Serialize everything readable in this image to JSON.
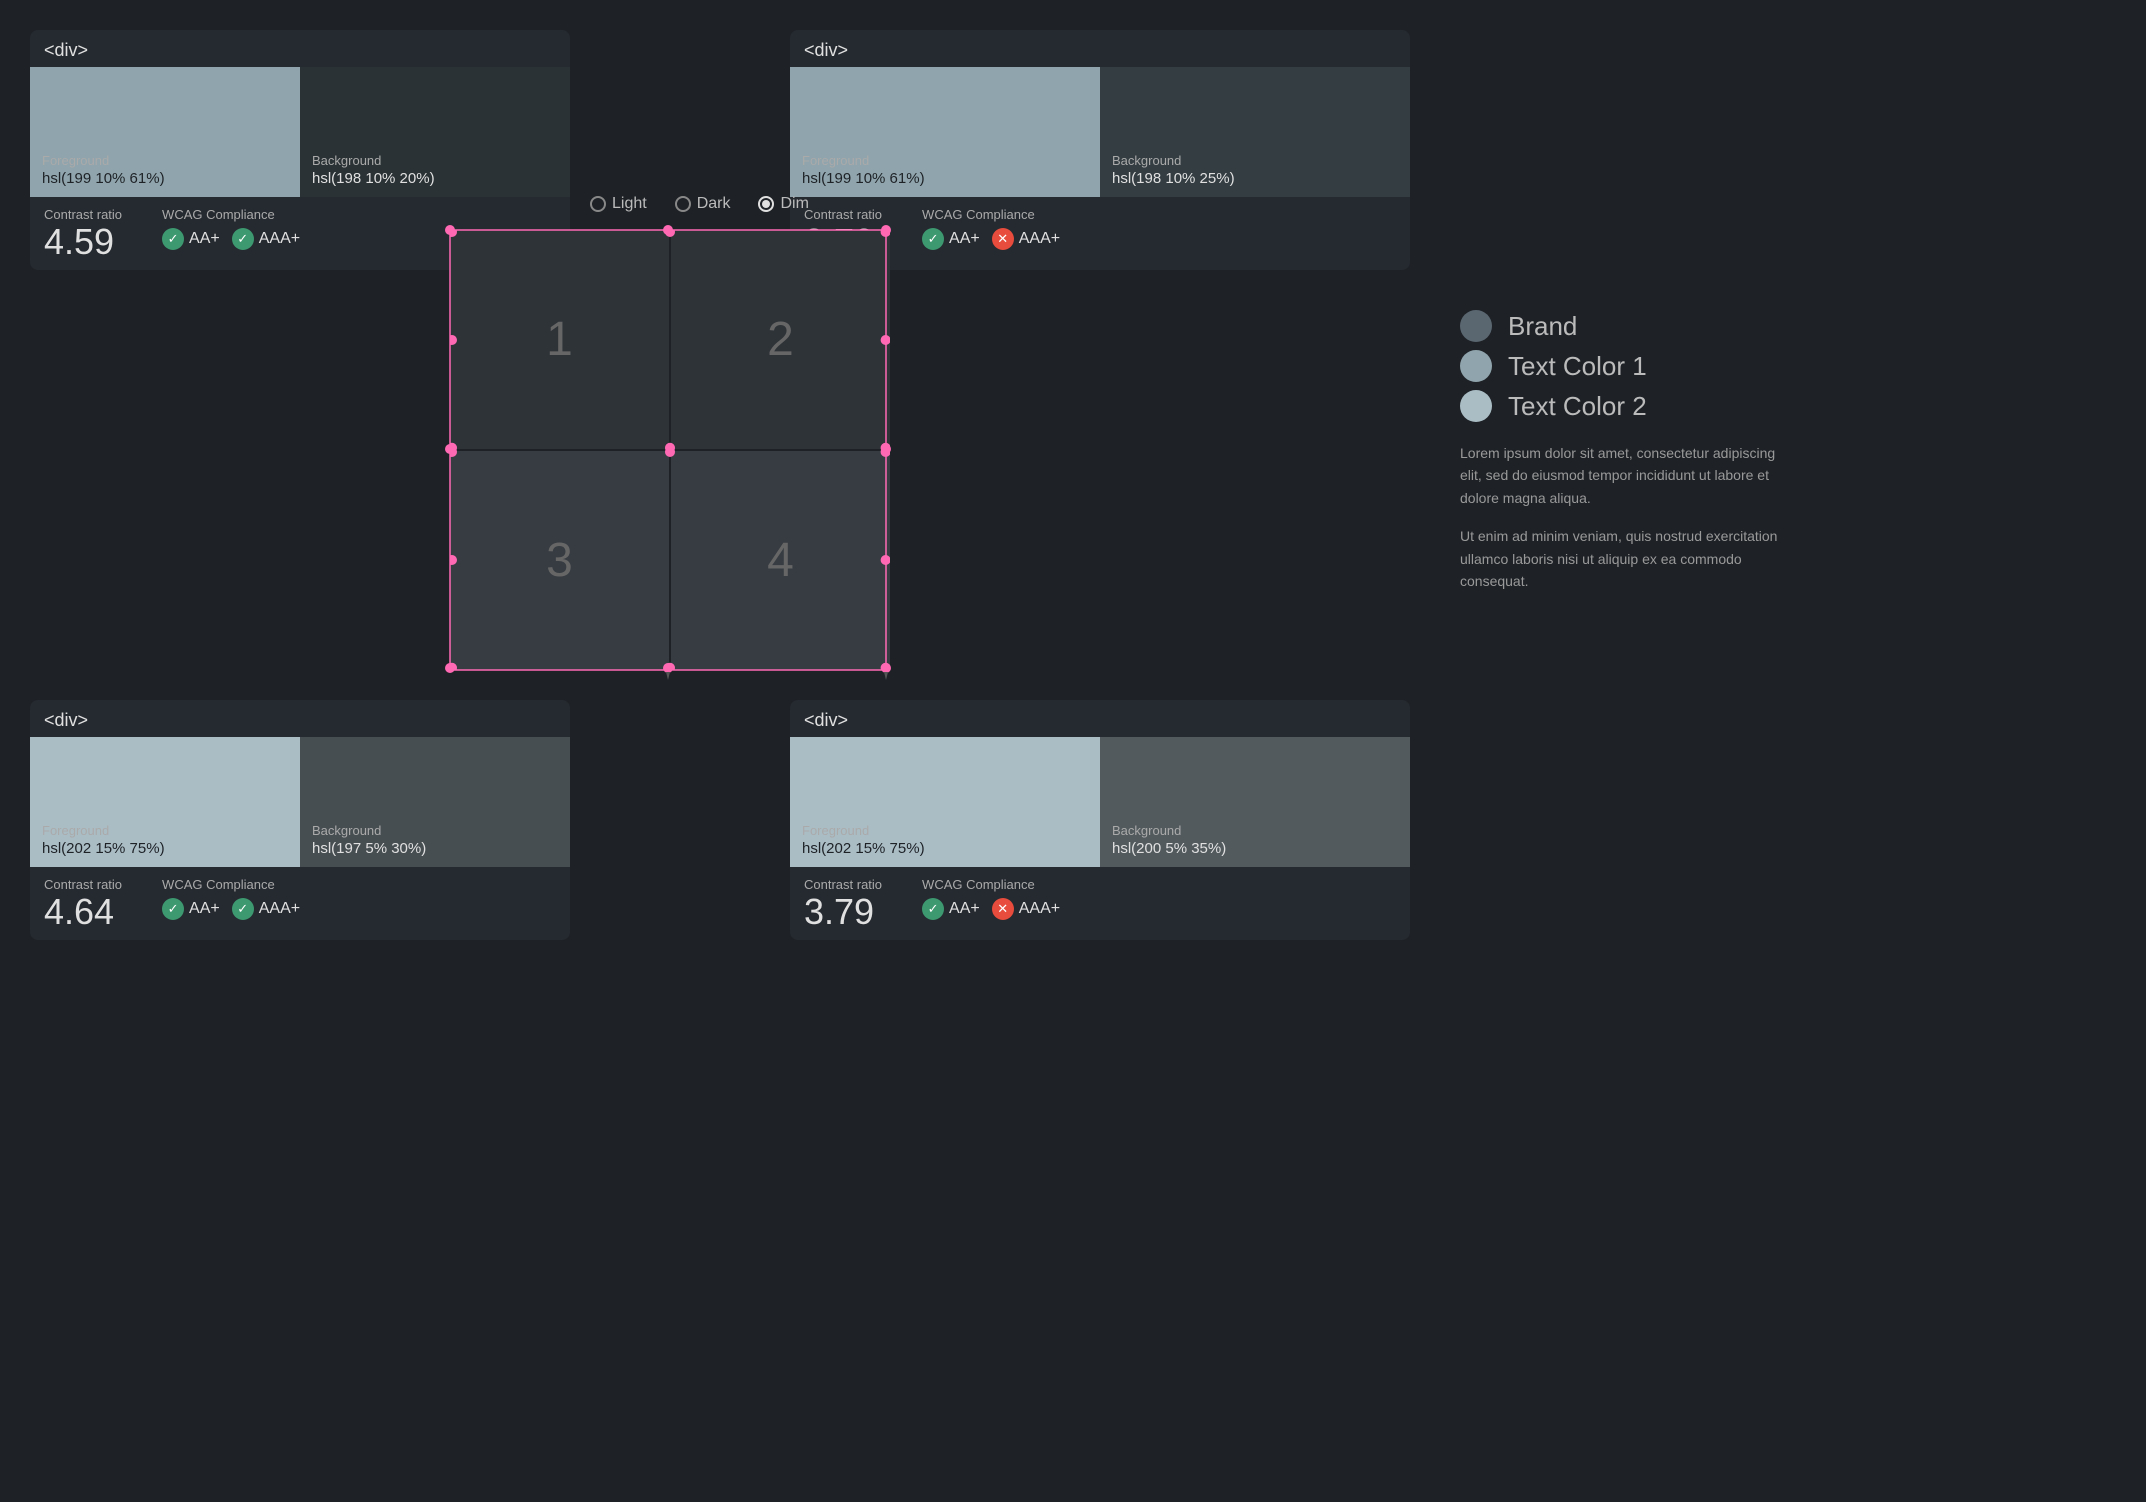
{
  "cards": {
    "top_left": {
      "tag": "<div>",
      "foreground_label": "Foreground",
      "foreground_value": "hsl(199 10% 61%)",
      "background_label": "Background",
      "background_value": "hsl(198 10% 20%)",
      "foreground_color": "#8fa4ac",
      "background_color": "#2a3235",
      "contrast_label": "Contrast ratio",
      "contrast_value": "4.59",
      "wcag_label": "WCAG Compliance",
      "badge_aa": "AA+",
      "badge_aaa": "AAA+",
      "aa_pass": true,
      "aaa_pass": true
    },
    "top_right": {
      "tag": "<div>",
      "foreground_label": "Foreground",
      "foreground_value": "hsl(199 10% 61%)",
      "background_label": "Background",
      "background_value": "hsl(198 10% 25%)",
      "foreground_color": "#8fa4ac",
      "background_color": "#333d42",
      "contrast_label": "Contrast ratio",
      "contrast_value": "3.78",
      "wcag_label": "WCAG Compliance",
      "badge_aa": "AA+",
      "badge_aaa": "AAA+",
      "aa_pass": true,
      "aaa_pass": false
    },
    "bottom_left": {
      "tag": "<div>",
      "foreground_label": "Foreground",
      "foreground_value": "hsl(202 15% 75%)",
      "background_label": "Background",
      "background_value": "hsl(197 5% 30%)",
      "foreground_color": "#aabdc5",
      "background_color": "#474e52",
      "contrast_label": "Contrast ratio",
      "contrast_value": "4.64",
      "wcag_label": "WCAG Compliance",
      "badge_aa": "AA+",
      "badge_aaa": "AAA+",
      "aa_pass": true,
      "aaa_pass": true
    },
    "bottom_right": {
      "tag": "<div>",
      "foreground_label": "Foreground",
      "foreground_value": "hsl(202 15% 75%)",
      "background_label": "Background",
      "background_value": "hsl(200 5% 35%)",
      "foreground_color": "#aabdc5",
      "background_color": "#525a5e",
      "contrast_label": "Contrast ratio",
      "contrast_value": "3.79",
      "wcag_label": "WCAG Compliance",
      "badge_aa": "AA+",
      "badge_aaa": "AAA+",
      "aa_pass": true,
      "aaa_pass": false
    }
  },
  "radio": {
    "light_label": "Light",
    "dark_label": "Dark",
    "dim_label": "Dim",
    "selected": "dim"
  },
  "grid": {
    "cells": [
      "1",
      "2",
      "3",
      "4"
    ]
  },
  "brand_items": [
    {
      "label": "Brand",
      "color": "#5a6670"
    },
    {
      "label": "Text Color 1",
      "color": "#8fa4ac"
    },
    {
      "label": "Text Color 2",
      "color": "#aabdc5"
    }
  ],
  "lorem": {
    "p1": "Lorem ipsum dolor sit amet, consectetur adipiscing elit, sed do eiusmod tempor incididunt ut labore et dolore magna aliqua.",
    "p2": "Ut enim ad minim veniam, quis nostrud exercitation ullamco laboris nisi ut aliquip ex ea commodo consequat."
  }
}
